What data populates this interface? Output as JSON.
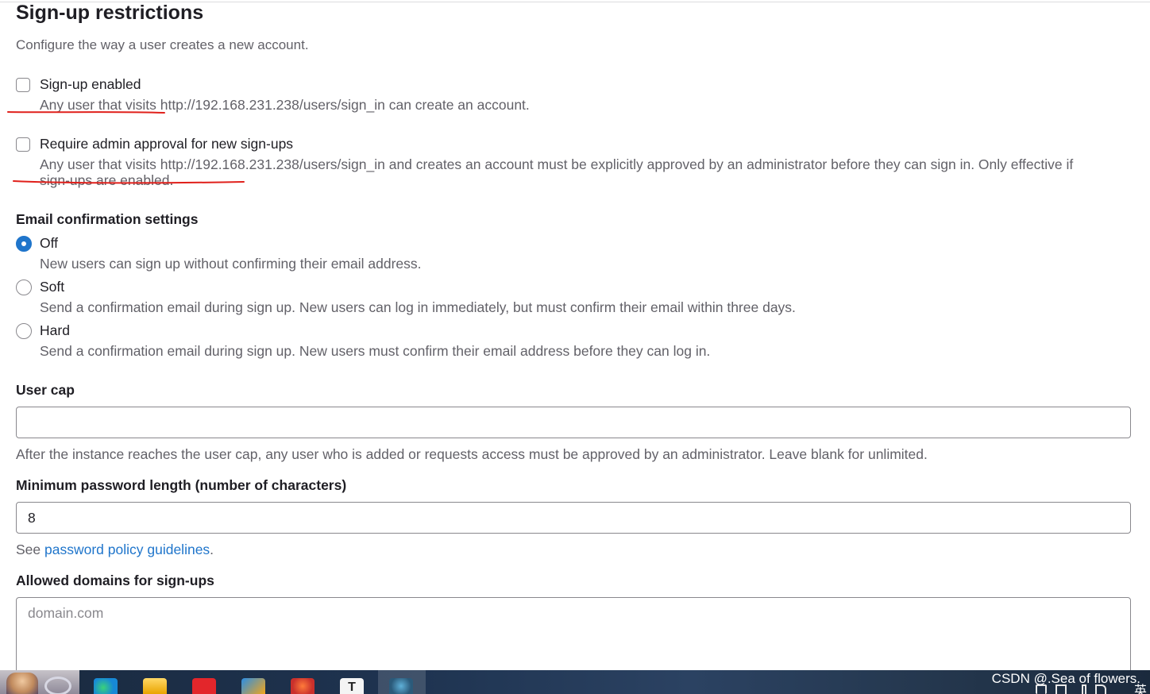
{
  "section": {
    "title": "Sign-up restrictions",
    "description": "Configure the way a user creates a new account."
  },
  "signup_enabled": {
    "label": "Sign-up enabled",
    "checked": false,
    "help": "Any user that visits http://192.168.231.238/users/sign_in can create an account."
  },
  "admin_approval": {
    "label": "Require admin approval for new sign-ups",
    "checked": false,
    "help": "Any user that visits http://192.168.231.238/users/sign_in and creates an account must be explicitly approved by an administrator before they can sign in. Only effective if sign-ups are enabled."
  },
  "email_confirmation": {
    "label": "Email confirmation settings",
    "selected": "Off",
    "options": [
      {
        "label": "Off",
        "help": "New users can sign up without confirming their email address."
      },
      {
        "label": "Soft",
        "help": "Send a confirmation email during sign up. New users can log in immediately, but must confirm their email within three days."
      },
      {
        "label": "Hard",
        "help": "Send a confirmation email during sign up. New users must confirm their email address before they can log in."
      }
    ]
  },
  "user_cap": {
    "label": "User cap",
    "value": "",
    "help": "After the instance reaches the user cap, any user who is added or requests access must be approved by an administrator. Leave blank for unlimited."
  },
  "min_password": {
    "label": "Minimum password length (number of characters)",
    "value": "8",
    "help_prefix": "See ",
    "help_link": "password policy guidelines",
    "help_suffix": "."
  },
  "allowed_domains": {
    "label": "Allowed domains for sign-ups",
    "placeholder": "domain.com",
    "value": ""
  },
  "colors": {
    "accent": "#1f75cb",
    "annotation": "#e0201b"
  },
  "taskbar": {
    "watermark": "CSDN @.Sea of flowers.",
    "ime": "英",
    "apps": [
      "edge-icon",
      "folder-icon",
      "netease-music-icon",
      "app-icon",
      "browser-icon",
      "typora-icon",
      "game-icon"
    ]
  }
}
